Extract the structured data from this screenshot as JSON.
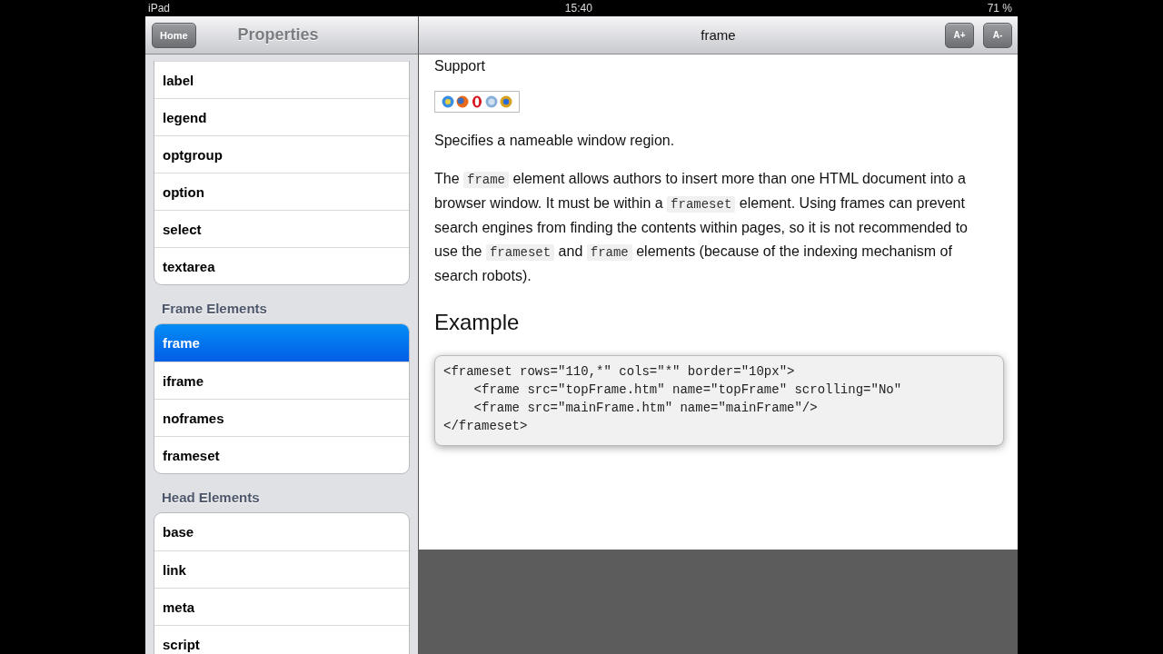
{
  "status_bar": {
    "device": "iPad",
    "time": "15:40",
    "battery": "71 %"
  },
  "sidebar": {
    "home_button": "Home",
    "title": "Properties",
    "groups": [
      {
        "items": [
          {
            "label": "label",
            "selected": false
          },
          {
            "label": "legend",
            "selected": false
          },
          {
            "label": "optgroup",
            "selected": false
          },
          {
            "label": "option",
            "selected": false
          },
          {
            "label": "select",
            "selected": false
          },
          {
            "label": "textarea",
            "selected": false
          }
        ]
      },
      {
        "header": "Frame Elements",
        "items": [
          {
            "label": "frame",
            "selected": true
          },
          {
            "label": "iframe",
            "selected": false
          },
          {
            "label": "noframes",
            "selected": false
          },
          {
            "label": "frameset",
            "selected": false
          }
        ]
      },
      {
        "header": "Head Elements",
        "items": [
          {
            "label": "base",
            "selected": false
          },
          {
            "label": "link",
            "selected": false
          },
          {
            "label": "meta",
            "selected": false
          },
          {
            "label": "script",
            "selected": false
          }
        ]
      }
    ]
  },
  "content": {
    "title": "frame",
    "buttons": [
      "A+",
      "A-"
    ],
    "support_heading": "Support",
    "summary": "Specifies a nameable window region.",
    "description": [
      {
        "kind": "text",
        "text": "The "
      },
      {
        "kind": "code",
        "text": "frame"
      },
      {
        "kind": "text",
        "text": " element allows authors to insert more than one HTML document into a browser window. It must be within a "
      },
      {
        "kind": "code",
        "text": "frameset"
      },
      {
        "kind": "text",
        "text": " element. Using frames can prevent search engines from finding the contents within pages, so it is not recommended to use the "
      },
      {
        "kind": "code",
        "text": "frameset"
      },
      {
        "kind": "text",
        "text": " and "
      },
      {
        "kind": "code",
        "text": "frame"
      },
      {
        "kind": "text",
        "text": " elements (because of the indexing mechanism of search robots)."
      }
    ],
    "example_heading": "Example",
    "code_lines": [
      "<frameset rows=\"110,*\" cols=\"*\" border=\"10px\">",
      "    <frame src=\"topFrame.htm\" name=\"topFrame\" scrolling=\"No\"",
      "    <frame src=\"mainFrame.htm\" name=\"mainFrame\"/>",
      "</frameset>"
    ]
  }
}
